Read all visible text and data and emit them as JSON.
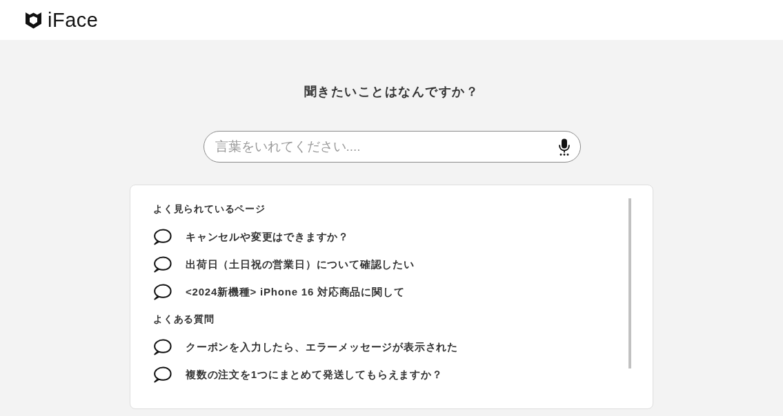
{
  "header": {
    "logo": "iFace"
  },
  "search": {
    "title": "聞きたいことはなんですか？",
    "placeholder": "言葉をいれてください...."
  },
  "suggestions": {
    "sections": [
      {
        "heading": "よく見られているページ",
        "items": [
          "キャンセルや変更はできますか？",
          "出荷日（土日祝の営業日）について確認したい",
          "<2024新機種> iPhone 16 対応商品に関して"
        ]
      },
      {
        "heading": "よくある質問",
        "items": [
          "クーポンを入力したら、エラーメッセージが表示された",
          "複数の注文を1つにまとめて発送してもらえますか？"
        ]
      }
    ]
  }
}
